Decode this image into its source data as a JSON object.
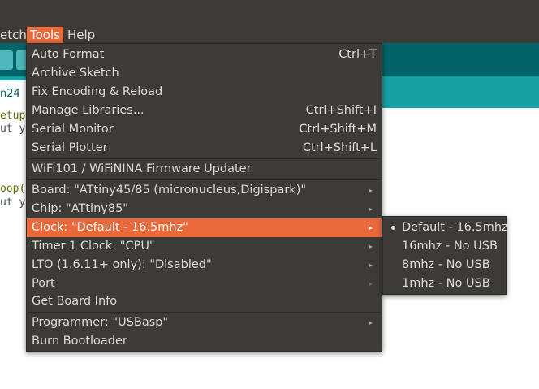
{
  "menubar": {
    "sketch": "etch",
    "tools": "Tools",
    "help": "Help"
  },
  "tab": {
    "label": "n24"
  },
  "code": [
    "etup",
    "ut y",
    "oop(",
    "ut y"
  ],
  "tools_menu": {
    "items": [
      {
        "label": "Auto Format",
        "shortcut": "Ctrl+T"
      },
      {
        "label": "Archive Sketch",
        "shortcut": ""
      },
      {
        "label": "Fix Encoding & Reload",
        "shortcut": ""
      },
      {
        "label": "Manage Libraries...",
        "shortcut": "Ctrl+Shift+I"
      },
      {
        "label": "Serial Monitor",
        "shortcut": "Ctrl+Shift+M"
      },
      {
        "label": "Serial Plotter",
        "shortcut": "Ctrl+Shift+L"
      },
      {
        "label": "WiFi101 / WiFiNINA Firmware Updater",
        "shortcut": ""
      },
      {
        "label": "Board: \"ATtiny45/85 (micronucleus,Digispark)\"",
        "submenu": true
      },
      {
        "label": "Chip: \"ATtiny85\"",
        "submenu": true
      },
      {
        "label": "Clock: \"Default - 16.5mhz\"",
        "submenu": true,
        "active": true
      },
      {
        "label": "Timer 1 Clock: \"CPU\"",
        "submenu": true
      },
      {
        "label": "LTO (1.6.11+ only): \"Disabled\"",
        "submenu": true
      },
      {
        "label": "Port",
        "submenu": true
      },
      {
        "label": "Get Board Info"
      },
      {
        "label": "Programmer: \"USBasp\"",
        "submenu": true
      },
      {
        "label": "Burn Bootloader"
      }
    ]
  },
  "clock_submenu": {
    "options": [
      "Default - 16.5mhz",
      "16mhz - No USB",
      "8mhz - No USB",
      "1mhz - No USB"
    ],
    "selected": "Default - 16.5mhz"
  },
  "colors": {
    "highlight": "#e9693a",
    "menu_bg": "#3c3b37",
    "menu_text": "#dfdbd2"
  },
  "icons": {
    "submenu_arrow": "▸",
    "radio_selected": "•"
  }
}
